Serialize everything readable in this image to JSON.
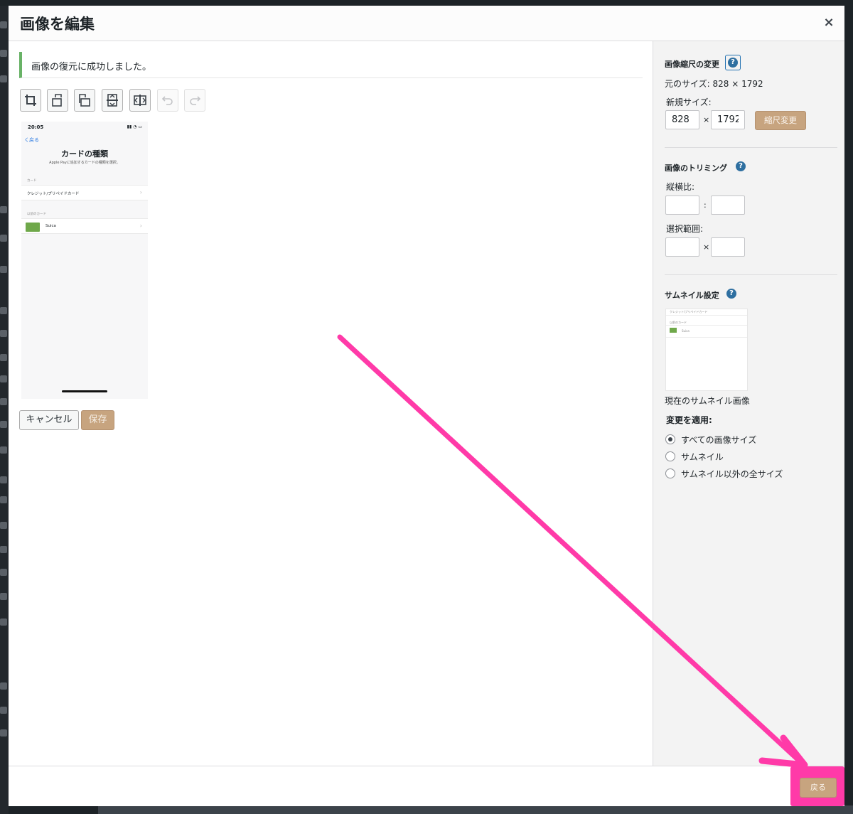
{
  "modal": {
    "title": "画像を編集",
    "close_icon": "close-icon",
    "close_glyph": "×"
  },
  "notice": {
    "text": "画像の復元に成功しました。"
  },
  "toolbar": {
    "icons": [
      "crop-icon",
      "rotate-left-icon",
      "rotate-right-icon",
      "flip-vertical-icon",
      "flip-horizontal-icon",
      "undo-icon",
      "redo-icon"
    ],
    "disabled": [
      "undo-icon",
      "redo-icon"
    ]
  },
  "preview": {
    "time": "20:05",
    "back": "く戻る",
    "title": "カードの種類",
    "subtitle": "Apple Payに追加するカードの種類を選択。",
    "section1": "カード",
    "row1": "クレジット/プリペイドカード",
    "section2": "以前のカード",
    "row2": "Suica",
    "chevron": "›"
  },
  "actions": {
    "cancel": "キャンセル",
    "save": "保存"
  },
  "scale": {
    "heading": "画像縮尺の変更",
    "original": "元のサイズ: 828 × 1792",
    "new_size_label": "新規サイズ:",
    "width": "828",
    "height": "1792",
    "times": "×",
    "button": "縮尺変更",
    "help": "?"
  },
  "crop": {
    "heading": "画像のトリミング",
    "help": "?",
    "ratio_label": "縦横比:",
    "ratio_sep": ":",
    "selection_label": "選択範囲:",
    "selection_sep": "×"
  },
  "thumbnail": {
    "heading": "サムネイル設定",
    "help": "?",
    "caption": "現在のサムネイル画像",
    "thumb_row": "クレジット/プリペイドカード",
    "thumb_section": "以前のカード",
    "thumb_card": "Suica",
    "apply_label": "変更を適用:",
    "options": [
      "すべての画像サイズ",
      "サムネイル",
      "サムネイル以外の全サイズ"
    ],
    "selected_index": 0
  },
  "footer": {
    "back": "戻る"
  },
  "colors": {
    "accent_button": "#c7a47f",
    "notice_green": "#68b266",
    "help_blue": "#2e6fa0",
    "highlight_pink": "#ff3aa8"
  }
}
